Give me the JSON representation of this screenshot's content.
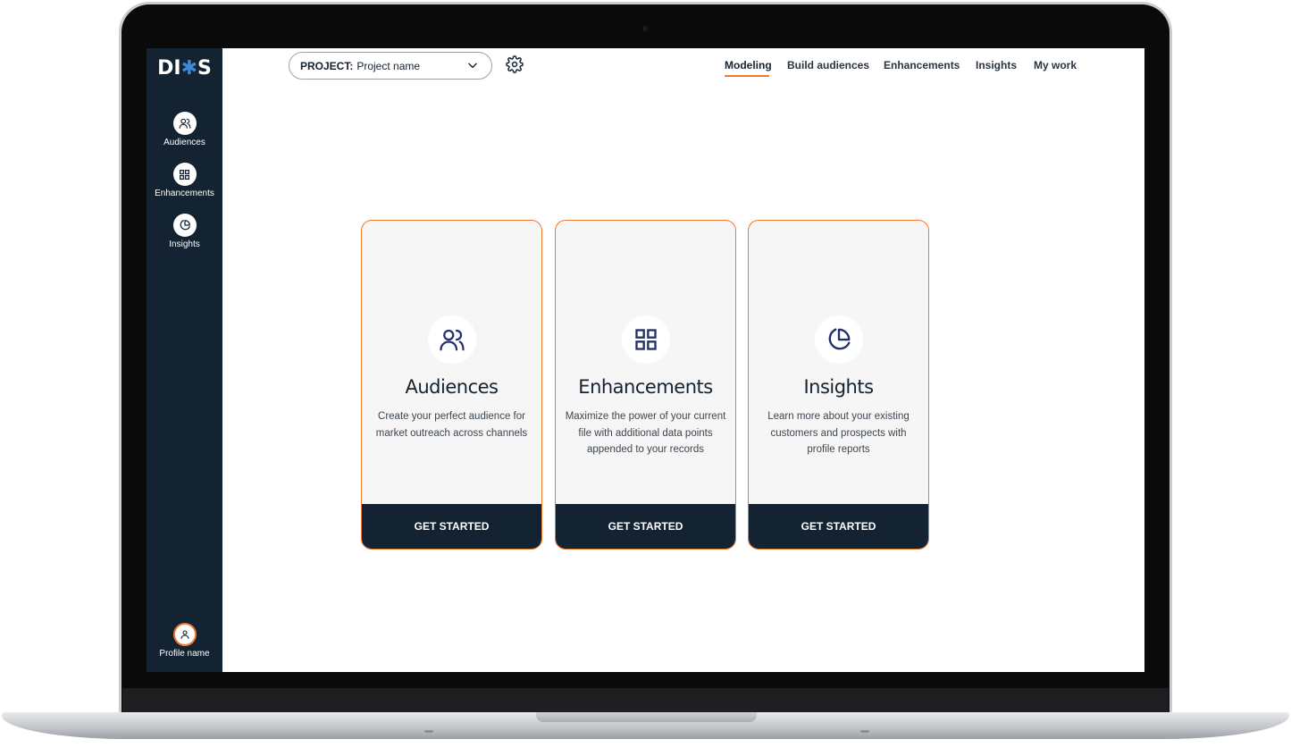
{
  "brand": {
    "logo_left": "DI",
    "logo_right": "S",
    "accent": "#f27a30",
    "sidebar_bg": "#142331",
    "logo_star": "#3f88d6"
  },
  "sidebar": {
    "items": [
      {
        "label": "Audiences",
        "icon": "users-icon"
      },
      {
        "label": "Enhancements",
        "icon": "grid-icon"
      },
      {
        "label": "Insights",
        "icon": "pie-chart-icon"
      }
    ],
    "profile": {
      "label": "Profile name",
      "icon": "user-icon"
    }
  },
  "header": {
    "project_prefix": "PROJECT:",
    "project_value": "Project name",
    "settings_icon": "gear-icon",
    "nav": [
      {
        "label": "Modeling",
        "active": true
      },
      {
        "label": "Build audiences",
        "active": false
      },
      {
        "label": "Enhancements",
        "active": false
      },
      {
        "label": "Insights",
        "active": false
      },
      {
        "label": "My work",
        "active": false
      }
    ]
  },
  "cards": [
    {
      "title": "Audiences",
      "description": "Create your perfect audience for market outreach across channels",
      "button": "GET STARTED",
      "icon": "users-icon"
    },
    {
      "title": "Enhancements",
      "description": "Maximize the power of your current file with additional data points appended to your records",
      "button": "GET STARTED",
      "icon": "grid-icon"
    },
    {
      "title": "Insights",
      "description": "Learn more about your existing customers and prospects with profile reports",
      "button": "GET STARTED",
      "icon": "pie-chart-icon"
    }
  ]
}
